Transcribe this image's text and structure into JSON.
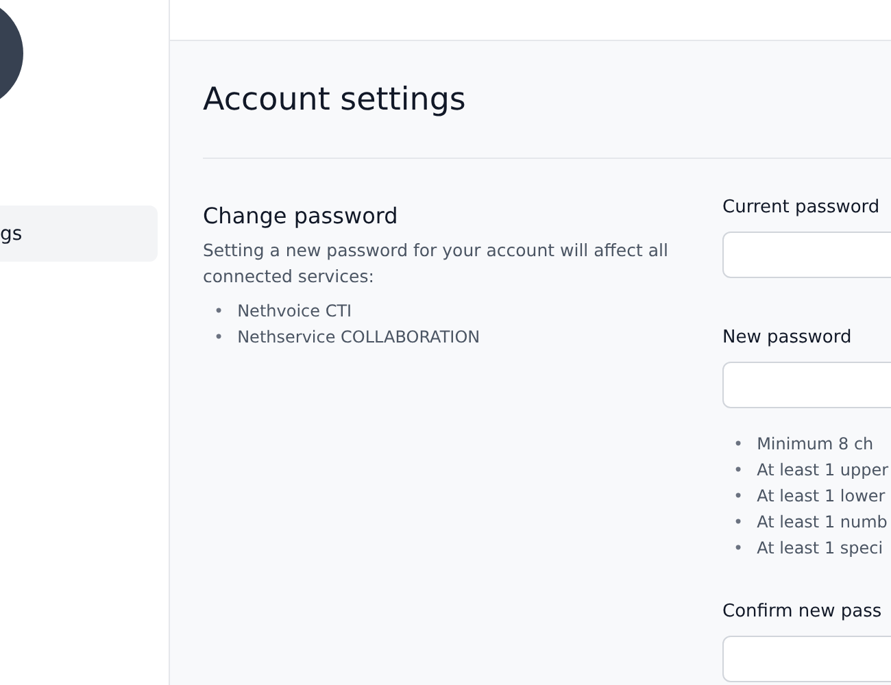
{
  "sidebar": {
    "items": [
      {
        "label": "gs",
        "selected": true
      }
    ]
  },
  "page": {
    "title": "Account settings"
  },
  "change_password": {
    "title": "Change password",
    "description": "Setting a new password for your account will affect all connected services:",
    "services": [
      {
        "bullet": "•",
        "text": "Nethvoice CTI"
      },
      {
        "bullet": "•",
        "text": "Nethservice COLLABORATION"
      }
    ]
  },
  "form": {
    "fields": [
      {
        "label": "Current password"
      },
      {
        "label": "New password",
        "requirements": [
          {
            "bullet": "•",
            "text": "Minimum 8 ch"
          },
          {
            "bullet": "•",
            "text": "At least 1 upper"
          },
          {
            "bullet": "•",
            "text": "At least 1 lower"
          },
          {
            "bullet": "•",
            "text": "At least 1 numb"
          },
          {
            "bullet": "•",
            "text": "At least 1 speci"
          }
        ]
      },
      {
        "label": "Confirm new pass"
      }
    ]
  }
}
